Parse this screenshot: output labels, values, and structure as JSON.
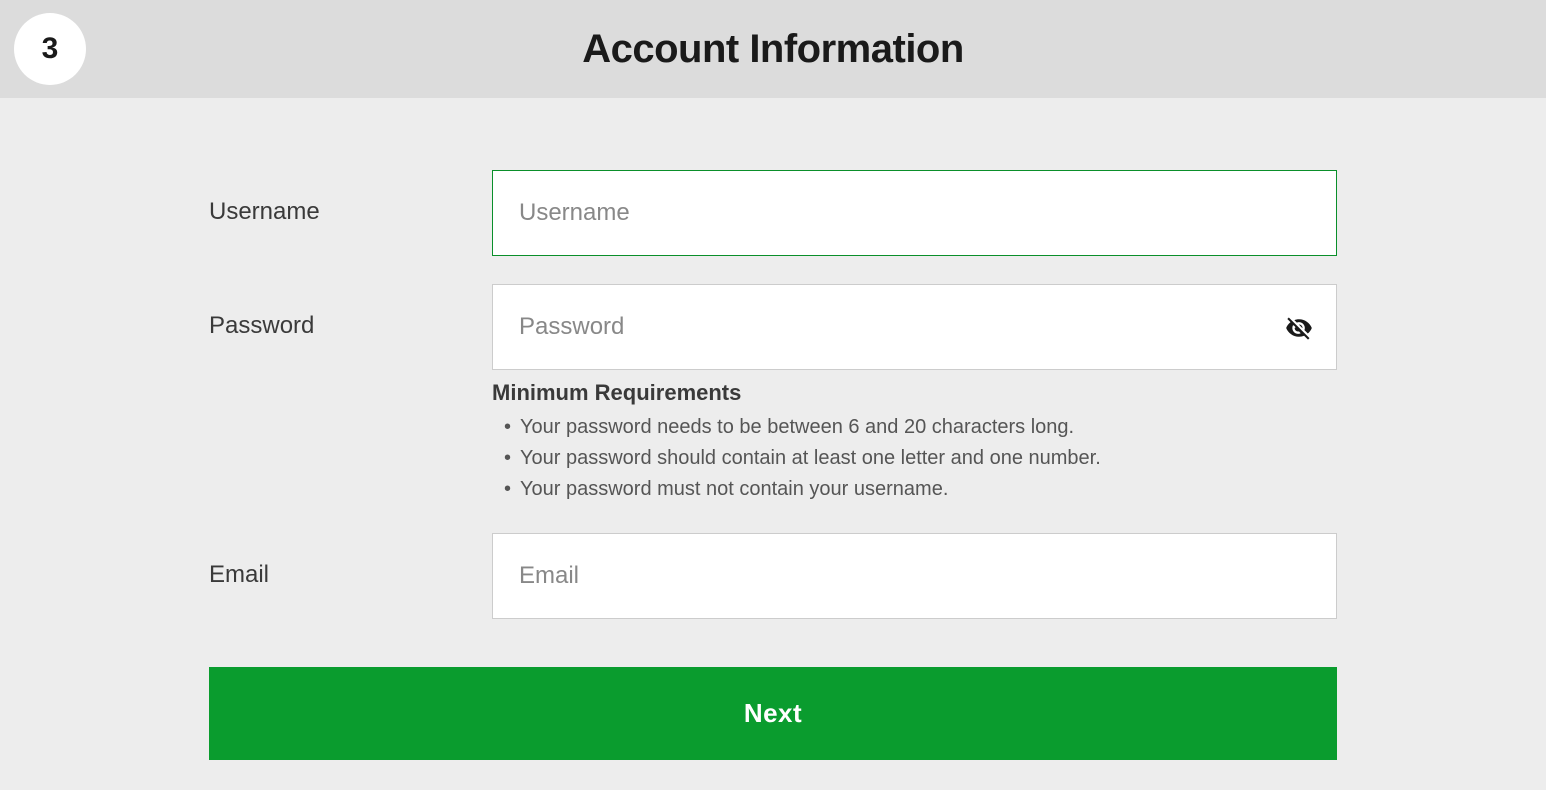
{
  "header": {
    "step_number": "3",
    "title": "Account Information"
  },
  "form": {
    "username": {
      "label": "Username",
      "placeholder": "Username"
    },
    "password": {
      "label": "Password",
      "placeholder": "Password",
      "requirements_title": "Minimum Requirements",
      "requirements": [
        "Your password needs to be between 6 and 20 characters long.",
        "Your password should contain at least one letter and one number.",
        "Your password must not contain your username."
      ]
    },
    "email": {
      "label": "Email",
      "placeholder": "Email"
    },
    "next_button": "Next"
  }
}
